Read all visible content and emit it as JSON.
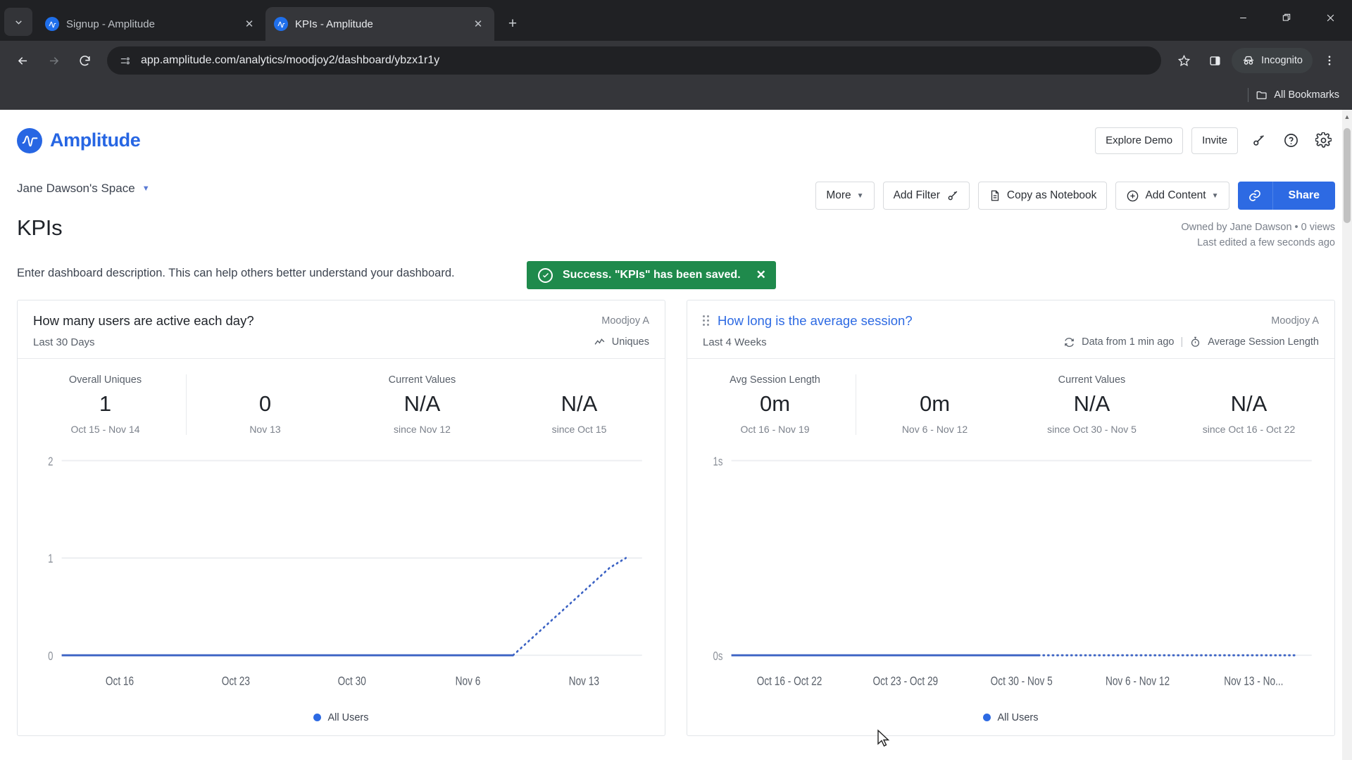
{
  "browser": {
    "tabs": [
      {
        "title": "Signup - Amplitude",
        "favicon": "amplitude-icon",
        "active": false
      },
      {
        "title": "KPIs - Amplitude",
        "favicon": "amplitude-icon",
        "active": true
      }
    ],
    "new_tab_label": "+",
    "tab_search_icon": "chevron-down-icon",
    "window_controls": {
      "minimize": "—",
      "maximize": "❐",
      "close": "✕"
    },
    "nav": {
      "back": "←",
      "forward": "→",
      "reload": "⟳"
    },
    "omnibox": {
      "url": "app.amplitude.com/analytics/moodjoy2/dashboard/ybzx1r1y",
      "site_icon": "page-info-icon"
    },
    "toolbar": {
      "bookmark_icon": "star-icon",
      "sidepanel_icon": "side-panel-icon",
      "profile_label": "Incognito",
      "menu_icon": "kebab-menu-icon"
    },
    "bookmarks_bar": {
      "all_bookmarks_label": "All Bookmarks",
      "folder_icon": "folder-icon"
    }
  },
  "app": {
    "brand": "Amplitude",
    "toast": {
      "message": "Success. \"KPIs\" has been saved.",
      "close": "✕",
      "color": "#1f8a4c"
    },
    "header_actions": {
      "explore_demo": "Explore Demo",
      "invite": "Invite",
      "wand_icon": "magic-wand-icon",
      "help_icon": "help-circle-icon",
      "settings_icon": "gear-icon"
    }
  },
  "dashboard": {
    "space": "Jane Dawson's Space",
    "title": "KPIs",
    "description": "Enter dashboard description. This can help others better understand your dashboard.",
    "owner_line": "Owned by Jane Dawson • 0 views",
    "edited_line": "Last edited a few seconds ago",
    "toolbar": {
      "more": "More",
      "add_filter": "Add Filter",
      "copy_notebook": "Copy as Notebook",
      "add_content": "Add Content",
      "share": "Share",
      "link_icon": "link-icon",
      "doc_icon": "document-icon",
      "plus_icon": "plus-circle-icon",
      "wand_icon": "magic-wand-icon"
    },
    "accent_color": "#2d6ae3"
  },
  "cards": [
    {
      "title": "How many users are active each day?",
      "owner": "Moodjoy A",
      "range": "Last 30 Days",
      "meta_right": "Uniques",
      "meta_icon": "line-chart-icon",
      "is_link": false,
      "has_drag_handle": false,
      "primary": {
        "caption": "Overall Uniques",
        "value": "1",
        "sub": "Oct 15 - Nov 14"
      },
      "current_values_title": "Current Values",
      "current_values": [
        {
          "value": "0",
          "sub": "Nov 13"
        },
        {
          "value": "N/A",
          "sub": "since Nov 12"
        },
        {
          "value": "N/A",
          "sub": "since Oct 15"
        }
      ],
      "legend": "All Users",
      "chart_data": {
        "type": "line",
        "title": "How many users are active each day?",
        "xlabel": "",
        "ylabel": "",
        "ylim": [
          0,
          2
        ],
        "yticks": [
          "0",
          "1",
          "2"
        ],
        "xticks": [
          "Oct 16",
          "Oct 23",
          "Oct 30",
          "Nov 6",
          "Nov 13"
        ],
        "grid": true,
        "legend_position": "bottom",
        "series": [
          {
            "name": "All Users",
            "color": "#3b62c4",
            "solid_values": [
              0,
              0,
              0,
              0,
              0,
              0,
              0,
              0,
              0,
              0,
              0,
              0,
              0,
              0,
              0,
              0,
              0,
              0,
              0,
              0,
              0,
              0,
              0,
              0,
              0,
              0,
              0,
              0,
              0
            ],
            "dotted_values": [
              0,
              0.15,
              0.3,
              0.45,
              0.6,
              0.75,
              0.9,
              1.0
            ]
          }
        ]
      }
    },
    {
      "title": "How long is the average session?",
      "owner": "Moodjoy A",
      "range": "Last 4 Weeks",
      "meta_refresh": "Data from 1 min ago",
      "meta_right": "Average Session Length",
      "refresh_icon": "refresh-icon",
      "meta_icon": "stopwatch-icon",
      "is_link": true,
      "has_drag_handle": true,
      "primary": {
        "caption": "Avg Session Length",
        "value": "0m",
        "sub": "Oct 16 - Nov 19"
      },
      "current_values_title": "Current Values",
      "current_values": [
        {
          "value": "0m",
          "sub": "Nov 6 - Nov 12"
        },
        {
          "value": "N/A",
          "sub": "since Oct 30 - Nov 5"
        },
        {
          "value": "N/A",
          "sub": "since Oct 16 - Oct 22"
        }
      ],
      "legend": "All Users",
      "chart_data": {
        "type": "line",
        "title": "How long is the average session?",
        "xlabel": "",
        "ylabel": "",
        "ylim": [
          0,
          1
        ],
        "yticks": [
          "0s",
          "1s"
        ],
        "xticks": [
          "Oct 16 - Oct 22",
          "Oct 23 - Oct 29",
          "Oct 30 - Nov 5",
          "Nov 6 - Nov 12",
          "Nov 13 - No..."
        ],
        "grid": true,
        "legend_position": "bottom",
        "series": [
          {
            "name": "All Users",
            "color": "#3b62c4",
            "solid_values": [
              0,
              0,
              0,
              0,
              0,
              0,
              0,
              0,
              0,
              0,
              0,
              0,
              0,
              0,
              0,
              0,
              0,
              0,
              0
            ],
            "dotted_values": [
              0,
              0,
              0,
              0,
              0,
              0,
              0,
              0,
              0,
              0,
              0,
              0,
              0,
              0,
              0,
              0
            ]
          }
        ]
      }
    }
  ]
}
